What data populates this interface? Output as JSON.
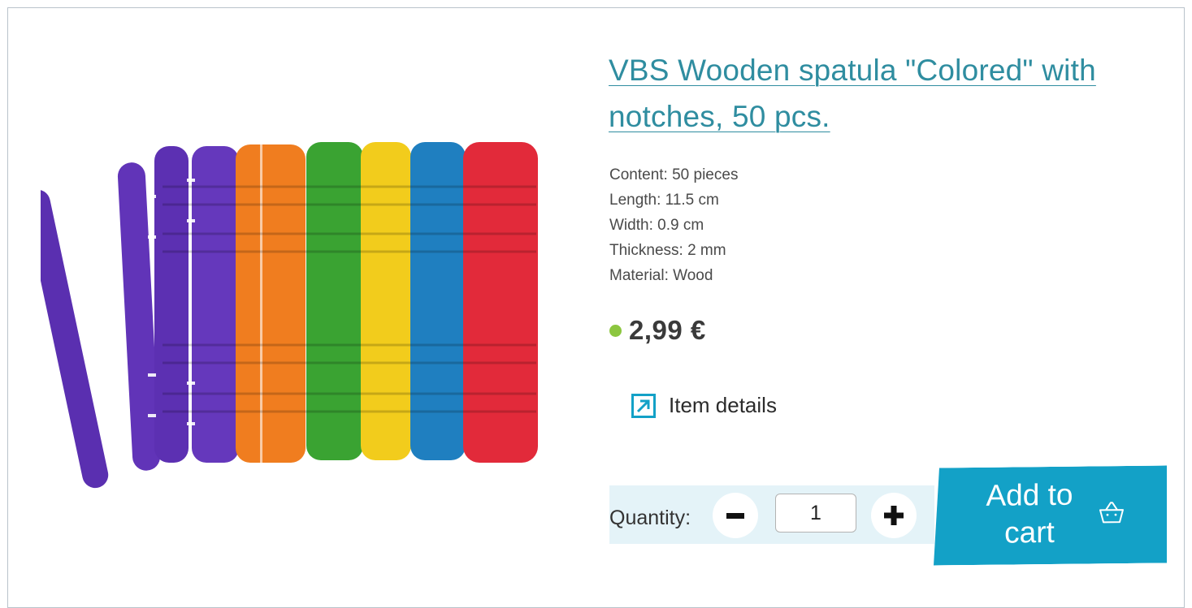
{
  "product": {
    "title": "VBS Wooden spatula \"Colored\" with notches, 50 pcs.",
    "image_alt": "Colored wooden spatulas with notches",
    "specs": [
      "Content: 50 pieces",
      "Length: 11.5 cm",
      "Width: 0.9 cm",
      "Thickness: 2 mm",
      "Material: Wood"
    ],
    "price": "2,99 €",
    "stock_color": "#8cc63f"
  },
  "details_link": {
    "label": "Item details",
    "icon": "external-arrow-icon"
  },
  "quantity": {
    "label": "Quantity:",
    "value": "1",
    "minus_icon": "minus-icon",
    "plus_icon": "plus-icon"
  },
  "cart": {
    "label": "Add to cart",
    "icon": "basket-icon",
    "color": "#13a1c7"
  },
  "colors": {
    "title": "#2f8da0",
    "accent": "#13a1c7",
    "quantity_bg": "#e4f3f8"
  }
}
